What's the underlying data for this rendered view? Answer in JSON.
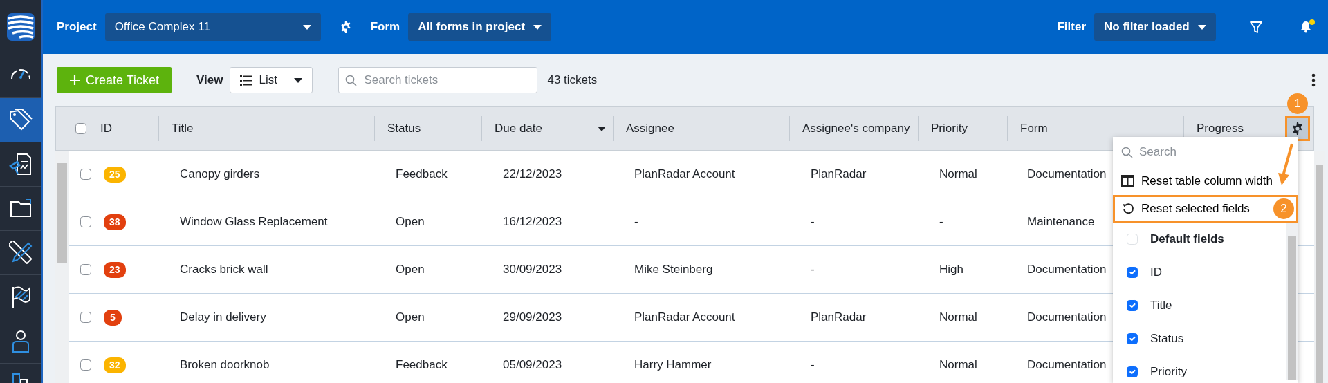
{
  "sidebar": {
    "items": [
      {
        "selected": false
      },
      {
        "selected": true
      },
      {
        "selected": false
      },
      {
        "selected": false
      },
      {
        "selected": false
      },
      {
        "selected": false
      },
      {
        "selected": false
      },
      {
        "selected": false
      }
    ]
  },
  "topbar": {
    "project": {
      "label": "Project",
      "value": "Office Complex 11"
    },
    "form": {
      "label": "Form",
      "value": "All forms in project"
    },
    "filter": {
      "label": "Filter",
      "value": "No filter loaded"
    },
    "notifications": {
      "unread": true
    }
  },
  "toolbar": {
    "create_button": "Create Ticket",
    "view": {
      "label": "View",
      "value": "List"
    },
    "search": {
      "placeholder": "Search tickets"
    },
    "count": "43 tickets"
  },
  "table": {
    "select_all": {
      "checked": false
    },
    "columns": [
      {
        "label": "ID"
      },
      {
        "label": "Title"
      },
      {
        "label": "Status"
      },
      {
        "label": "Due date",
        "sorted": true
      },
      {
        "label": "Assignee"
      },
      {
        "label": "Assignee's company"
      },
      {
        "label": "Priority"
      },
      {
        "label": "Form"
      },
      {
        "label": "Progress"
      }
    ],
    "settings": {
      "highlighted": true,
      "callout": "1"
    },
    "rows": [
      {
        "checked": false,
        "id": "25",
        "color": "#fbb400",
        "title": "Canopy girders",
        "status": "Feedback",
        "due": "22/12/2023",
        "assignee": "PlanRadar Account",
        "company": "PlanRadar",
        "priority": "Normal",
        "form": "Documentation"
      },
      {
        "checked": false,
        "id": "38",
        "color": "#e2400f",
        "title": "Window Glass Replacement",
        "status": "Open",
        "due": "16/12/2023",
        "assignee": "-",
        "company": "-",
        "priority": "-",
        "form": "Maintenance"
      },
      {
        "checked": false,
        "id": "23",
        "color": "#e2400f",
        "title": "Cracks brick wall",
        "status": "Open",
        "due": "30/09/2023",
        "assignee": "Mike Steinberg",
        "company": "-",
        "priority": "High",
        "form": "Documentation"
      },
      {
        "checked": false,
        "id": "5",
        "color": "#e2400f",
        "title": "Delay in delivery",
        "status": "Open",
        "due": "29/09/2023",
        "assignee": "PlanRadar Account",
        "company": "PlanRadar",
        "priority": "Normal",
        "form": "Documentation"
      },
      {
        "checked": false,
        "id": "32",
        "color": "#fbb400",
        "title": "Broken doorknob",
        "status": "Feedback",
        "due": "05/09/2023",
        "assignee": "Harry Hammer",
        "company": "-",
        "priority": "Normal",
        "form": "Documentation"
      }
    ]
  },
  "column_menu": {
    "search": {
      "placeholder": "Search"
    },
    "actions": [
      {
        "label": "Reset table column width",
        "highlighted": false
      },
      {
        "label": "Reset selected fields",
        "highlighted": true,
        "callout": "2"
      }
    ],
    "fields": [
      {
        "kind": "group",
        "label": "Default fields",
        "checked": false
      },
      {
        "kind": "field",
        "label": "ID",
        "checked": true
      },
      {
        "kind": "field",
        "label": "Title",
        "checked": true
      },
      {
        "kind": "field",
        "label": "Status",
        "checked": true
      },
      {
        "kind": "field",
        "label": "Priority",
        "checked": true
      }
    ]
  }
}
